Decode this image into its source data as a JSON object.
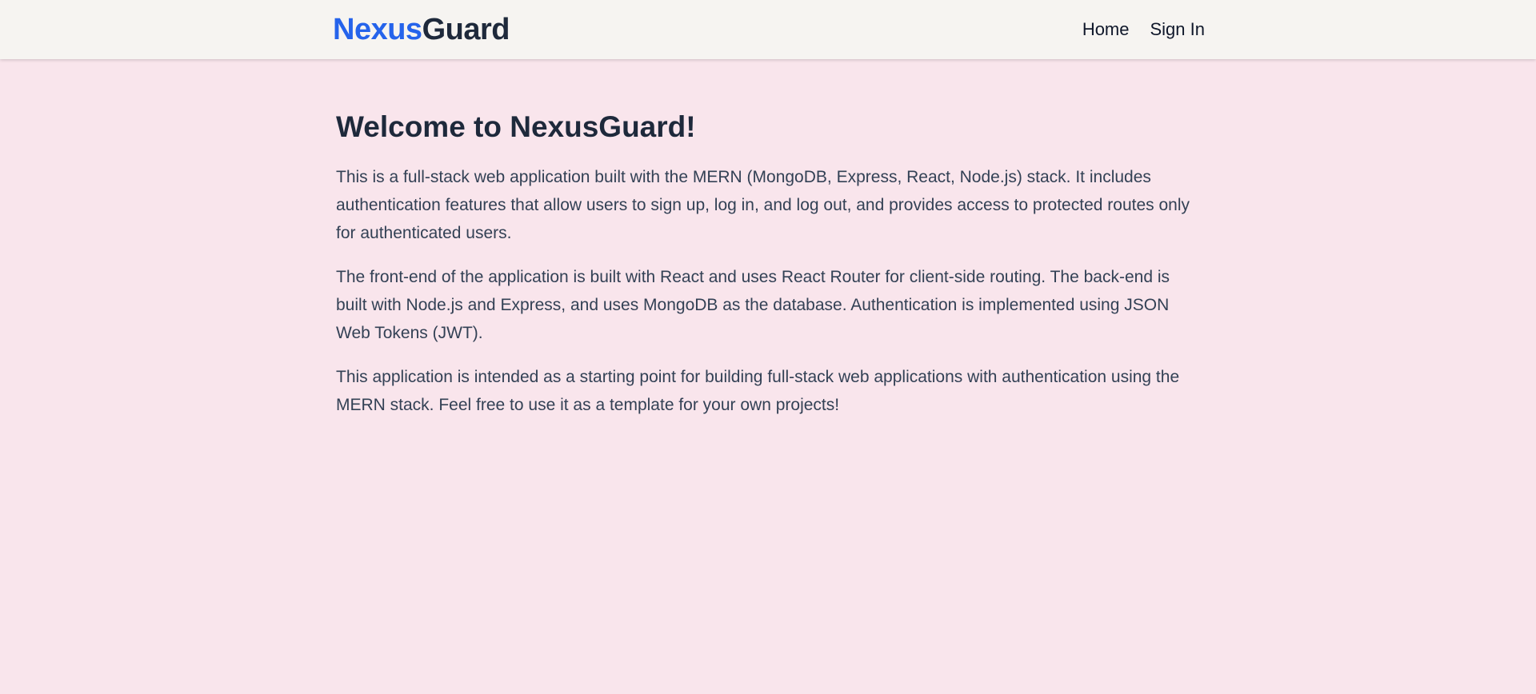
{
  "header": {
    "logo_part1": "Nexus",
    "logo_part2": "Guard",
    "nav": [
      {
        "label": "Home"
      },
      {
        "label": "Sign In"
      }
    ]
  },
  "main": {
    "title": "Welcome to NexusGuard!",
    "paragraphs": [
      "This is a full-stack web application built with the MERN (MongoDB, Express, React, Node.js) stack. It includes authentication features that allow users to sign up, log in, and log out, and provides access to protected routes only for authenticated users.",
      "The front-end of the application is built with React and uses React Router for client-side routing. The back-end is built with Node.js and Express, and uses MongoDB as the database. Authentication is implemented using JSON Web Tokens (JWT).",
      "This application is intended as a starting point for building full-stack web applications with authentication using the MERN stack. Feel free to use it as a template for your own projects!"
    ]
  },
  "colors": {
    "background": "#f9e5ec",
    "header_background": "#f6f4f1",
    "logo_accent": "#2563eb",
    "logo_dark": "#1e293b"
  }
}
